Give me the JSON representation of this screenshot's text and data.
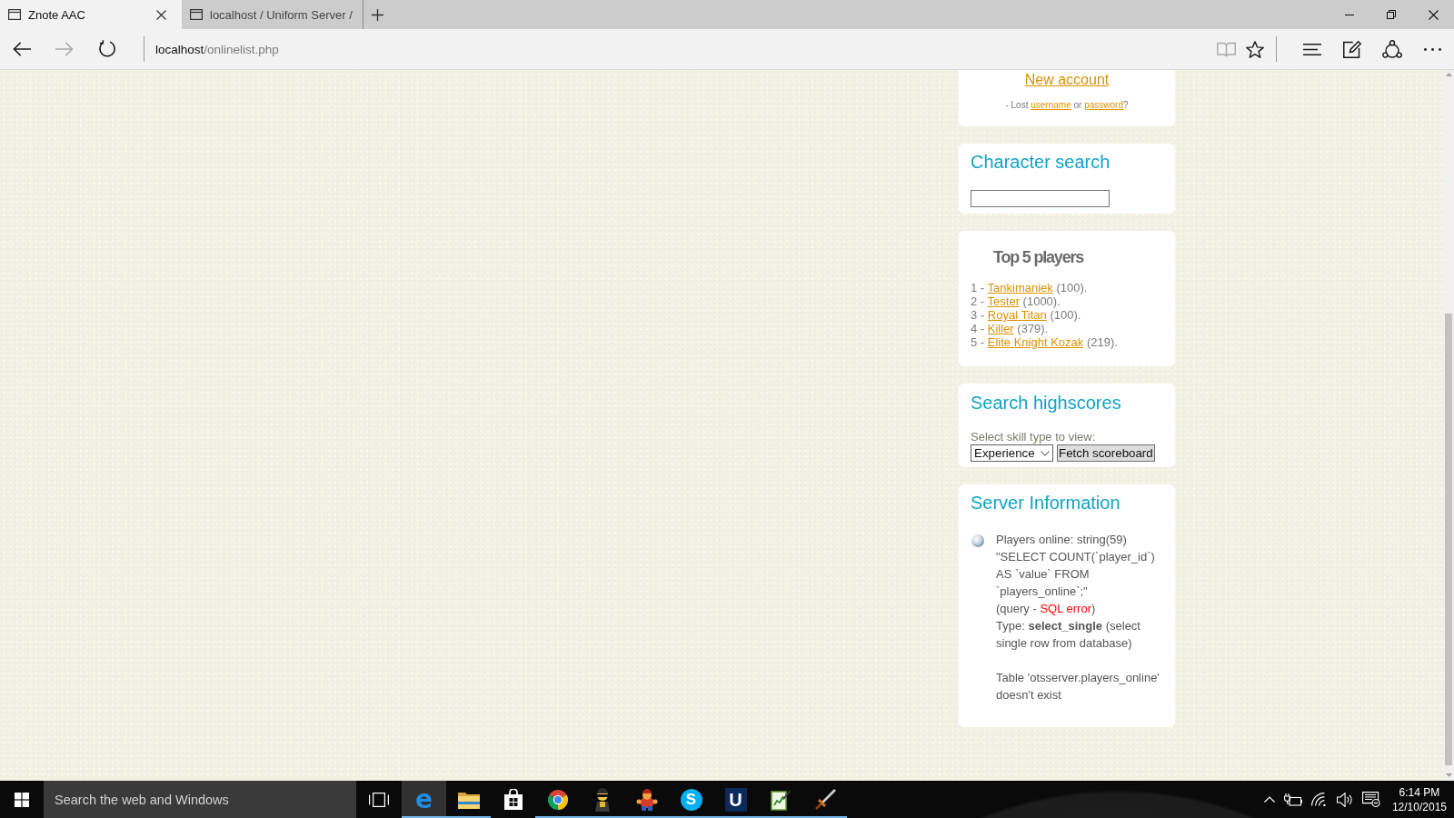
{
  "browser": {
    "tabs": [
      {
        "title": "Znote AAC",
        "selected": true
      },
      {
        "title": "localhost / Uniform Server /",
        "selected": false
      }
    ],
    "nav_buttons": [
      {
        "kind": "back",
        "disabled": false
      },
      {
        "kind": "forward",
        "disabled": true
      },
      {
        "kind": "refresh",
        "disabled": false
      }
    ],
    "address": {
      "host": "localhost",
      "path": "/onlinelist.php"
    },
    "page_actions": [
      {
        "kind": "reading-view",
        "disabled": true
      },
      {
        "kind": "favorite",
        "disabled": false
      }
    ],
    "toolbar_buttons": [
      {
        "kind": "hub"
      },
      {
        "kind": "note"
      },
      {
        "kind": "share"
      },
      {
        "kind": "more"
      }
    ]
  },
  "sidebar": {
    "account_box": {
      "new_account_link": "New account",
      "recovery": {
        "prefix": "- Lost",
        "username_link": "username",
        "middle": "or",
        "password_link": "password",
        "suffix": "?"
      }
    },
    "character_search": {
      "title": "Character search"
    },
    "top_players": {
      "title": "Top 5 players",
      "players": [
        {
          "rank": "1 -",
          "name": "Tankimaniek",
          "score": "(100)."
        },
        {
          "rank": "2 -",
          "name": "Tester",
          "score": "(1000)."
        },
        {
          "rank": "3 -",
          "name": "Royal Titan",
          "score": "(100)."
        },
        {
          "rank": "4 -",
          "name": "Killer",
          "score": "(379)."
        },
        {
          "rank": "5 -",
          "name": "Elite Knight Kozak",
          "score": "(219)."
        }
      ]
    },
    "highscores": {
      "title": "Search highscores",
      "label": "Select skill type to view:",
      "skill_select": {
        "value": "Experience"
      },
      "button": "Fetch scoreboard"
    },
    "server_info": {
      "title": "Server Information",
      "paragraphs": [
        {
          "kind": "text",
          "text": "Players online: string(59) \"SELECT COUNT(`player_id`) AS `value` FROM `players_online`;\""
        },
        {
          "kind": "error",
          "prefix": "(query -",
          "error": "SQL error",
          "suffix": ")"
        },
        {
          "kind": "details",
          "text": "Type: **select_single** (select single row from database)"
        },
        {
          "kind": "note",
          "text": "Table 'otsserver.players_online' doesn't exist"
        }
      ]
    }
  },
  "taskbar": {
    "search": {
      "placeholder": "Search the web and Windows"
    },
    "apps": [
      {
        "kind": "edge",
        "glyph": "e",
        "running": true,
        "selected": true
      },
      {
        "kind": "file-explorer",
        "running": true,
        "selected": false
      },
      {
        "kind": "store",
        "running": false,
        "selected": false
      },
      {
        "kind": "chrome",
        "running": true,
        "selected": false
      },
      {
        "kind": "game-character",
        "running": true,
        "selected": false
      },
      {
        "kind": "game-hero",
        "running": true,
        "selected": false
      },
      {
        "kind": "skype",
        "glyph": "S",
        "running": true,
        "selected": false
      },
      {
        "kind": "launcher",
        "glyph": "U",
        "running": true,
        "selected": false
      },
      {
        "kind": "chart-editor",
        "running": true,
        "selected": false
      },
      {
        "kind": "sword-game",
        "running": true,
        "selected": false
      }
    ],
    "clock": {
      "time": "6:14 PM",
      "date": "12/10/2015"
    }
  }
}
